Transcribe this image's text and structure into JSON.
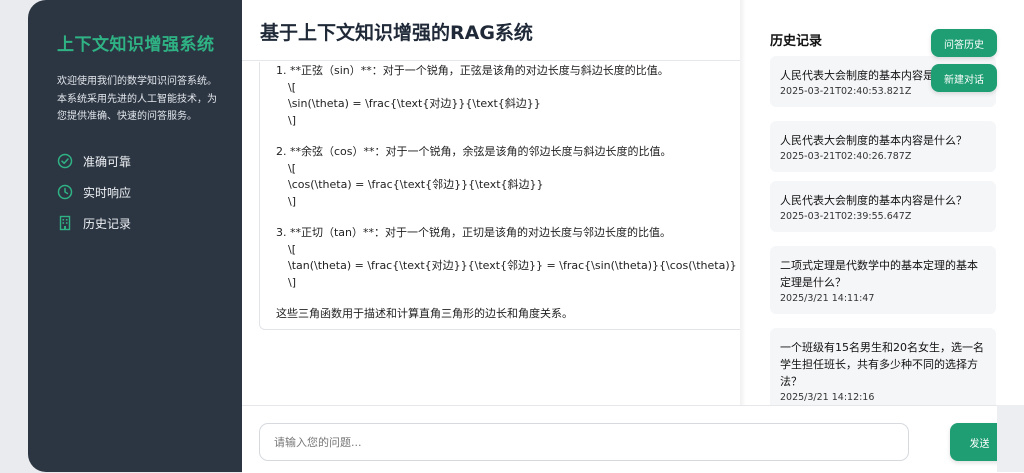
{
  "sidebar": {
    "brand": "上下文知识增强系统",
    "intro": "欢迎使用我们的数学知识问答系统。本系统采用先进的人工智能技术，为您提供准确、快速的问答服务。",
    "features": [
      {
        "label": "准确可靠",
        "icon": "check-circle-icon"
      },
      {
        "label": "实时响应",
        "icon": "clock-icon"
      },
      {
        "label": "历史记录",
        "icon": "building-icon"
      }
    ]
  },
  "main": {
    "title": "基于上下文知识增强的RAG系统",
    "answer": {
      "items": [
        {
          "heading": "1. **正弦（sin）**：对于一个锐角，正弦是该角的对边长度与斜边长度的比值。",
          "formula": [
            "\\[",
            "\\sin(\\theta) = \\frac{\\text{对边}}{\\text{斜边}}",
            "\\]"
          ]
        },
        {
          "heading": "2. **余弦（cos）**：对于一个锐角，余弦是该角的邻边长度与斜边长度的比值。",
          "formula": [
            "\\[",
            "\\cos(\\theta) = \\frac{\\text{邻边}}{\\text{斜边}}",
            "\\]"
          ]
        },
        {
          "heading": "3. **正切（tan）**：对于一个锐角，正切是该角的对边长度与邻边长度的比值。",
          "formula": [
            "\\[",
            "\\tan(\\theta) = \\frac{\\text{对边}}{\\text{邻边}} = \\frac{\\sin(\\theta)}{\\cos(\\theta)}",
            "\\]"
          ]
        }
      ],
      "summary": "这些三角函数用于描述和计算直角三角形的边长和角度关系。"
    }
  },
  "history": {
    "title": "历史记录",
    "items": [
      {
        "question": "人民代表大会制度的基本内容是什么？",
        "time": "2025-03-21T02:40:53.821Z"
      },
      {
        "question": "人民代表大会制度的基本内容是什么？",
        "time": "2025-03-21T02:40:26.787Z"
      },
      {
        "question": "人民代表大会制度的基本内容是什么？",
        "time": "2025-03-21T02:39:55.647Z"
      },
      {
        "question": "二项式定理是代数学中的基本定理的基本定理是什么？",
        "time": "2025/3/21 14:11:47"
      },
      {
        "question": "一个班级有15名男生和20名女生，选一名学生担任班长，共有多少种不同的选择方法？",
        "time": "2025/3/21 14:12:16"
      }
    ]
  },
  "buttons": {
    "history": "问答历史",
    "new_chat": "新建对话",
    "send": "发送"
  },
  "input": {
    "placeholder": "请输入您的问题...",
    "value": ""
  },
  "colors": {
    "accent": "#1f9e74",
    "brand_text": "#2fb384",
    "sidebar_bg": "#2c3542"
  }
}
